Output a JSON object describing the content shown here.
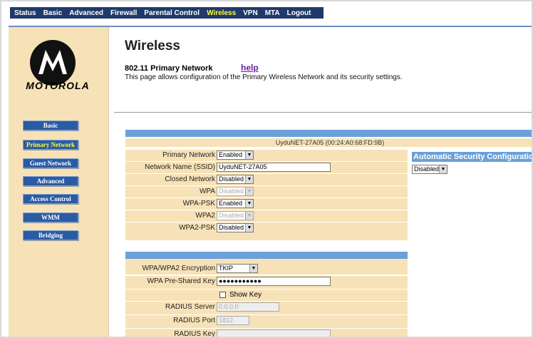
{
  "topnav": {
    "items": [
      "Status",
      "Basic",
      "Advanced",
      "Firewall",
      "Parental Control",
      "Wireless",
      "VPN",
      "MTA",
      "Logout"
    ],
    "active": "Wireless"
  },
  "brand": {
    "name": "MOTOROLA",
    "logo_icon": "motorola-batwing-icon"
  },
  "sidebar": {
    "items": [
      "Basic",
      "Primary Network",
      "Guest Network",
      "Advanced",
      "Access Control",
      "WMM",
      "Bridging"
    ],
    "active": "Primary Network"
  },
  "header": {
    "title": "Wireless",
    "subtitle": "802.11 Primary Network",
    "help": "help",
    "description": "This page allows configuration of the Primary Wireless Network and its security settings."
  },
  "network": {
    "bssid_label": "UyduNET-27A05 (00:24:A0:68:FD:9B)",
    "rows": [
      {
        "label": "Primary Network",
        "value": "Enabled",
        "type": "select",
        "disabled": false
      },
      {
        "label": "Network Name (SSID)",
        "value": "UyduNET-27A05",
        "type": "text",
        "disabled": false
      },
      {
        "label": "Closed Network",
        "value": "Disabled",
        "type": "select",
        "disabled": false
      },
      {
        "label": "WPA",
        "value": "Disabled",
        "type": "select",
        "disabled": true
      },
      {
        "label": "WPA-PSK",
        "value": "Enabled",
        "type": "select",
        "disabled": false
      },
      {
        "label": "WPA2",
        "value": "Disabled",
        "type": "select",
        "disabled": true
      },
      {
        "label": "WPA2-PSK",
        "value": "Disabled",
        "type": "select",
        "disabled": false
      }
    ]
  },
  "security": {
    "encryption_label": "WPA/WPA2 Encryption",
    "encryption_value": "TKIP",
    "psk_label": "WPA Pre-Shared Key",
    "psk_value": "●●●●●●●●●●●",
    "show_key_label": "Show Key",
    "radius_server_label": "RADIUS Server",
    "radius_server_value": "0.0.0.0",
    "radius_port_label": "RADIUS Port",
    "radius_port_value": "1812",
    "radius_key_label": "RADIUS Key",
    "radius_key_value": ""
  },
  "auto_security": {
    "title": "Automatic Security Configuration",
    "value": "Disabled"
  },
  "colors": {
    "nav_bg": "#1f3a6a",
    "active_text": "#ffff33",
    "panel_bg": "#f7e2b7",
    "bar_blue": "#6ba0d8",
    "button_blue": "#2a5ba5"
  }
}
